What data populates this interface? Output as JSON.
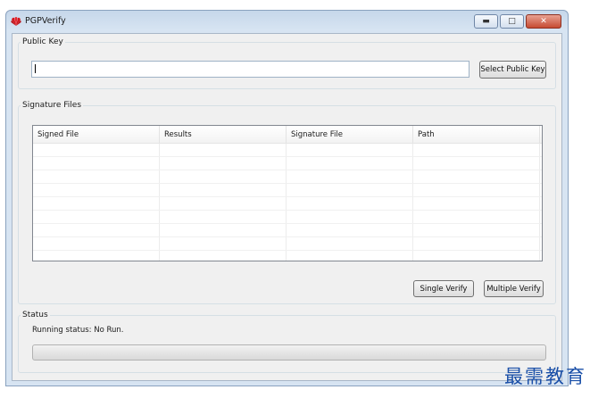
{
  "window": {
    "title": "PGPVerify",
    "controls": {
      "minimize": "▭",
      "maximize": "▢",
      "close": "✕"
    }
  },
  "public_key": {
    "group_label": "Public Key",
    "value": "",
    "button_label": "Select Public Key"
  },
  "signature_files": {
    "group_label": "Signature Files",
    "columns": [
      "Signed File",
      "Results",
      "Signature File",
      "Path"
    ],
    "rows": [],
    "single_verify_label": "Single Verify",
    "multiple_verify_label": "Multiple Verify"
  },
  "status": {
    "group_label": "Status",
    "running_status": "Running status: No Run.",
    "progress": 0
  },
  "watermark": "最需教育",
  "colors": {
    "accent": "#c8102e",
    "title_bar": "#d7e4f2",
    "close_button": "#c64b32"
  }
}
